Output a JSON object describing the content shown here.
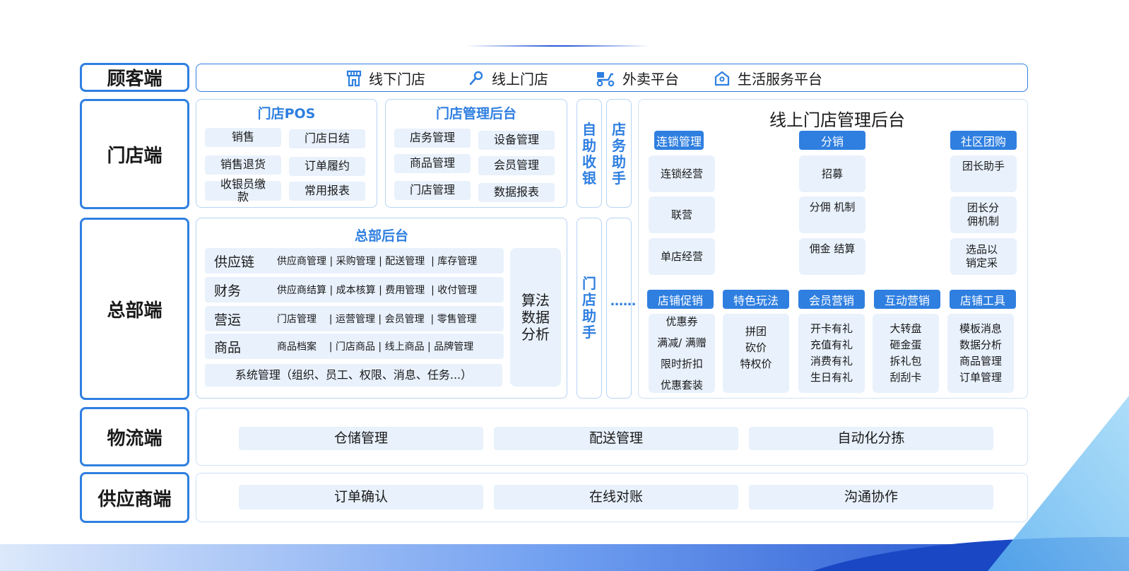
{
  "colors": {
    "accent": "#2f7fe0",
    "chip_bg": "#e8f1fc",
    "panel_border": "#b7d3f4"
  },
  "rows": {
    "customer": "顾客端",
    "store": "门店端",
    "hq": "总部端",
    "logistics": "物流端",
    "supplier": "供应商端"
  },
  "customer_items": [
    {
      "icon": "storefront-icon",
      "label": "线下门店"
    },
    {
      "icon": "link-icon",
      "label": "线上门店"
    },
    {
      "icon": "delivery-scooter-icon",
      "label": "外卖平台"
    },
    {
      "icon": "home-service-icon",
      "label": "生活服务平台"
    }
  ],
  "store_pos": {
    "title": "门店POS",
    "items": [
      "销售",
      "门店日结",
      "销售退货",
      "订单履约",
      "收银员缴款",
      "常用报表"
    ]
  },
  "store_admin": {
    "title": "门店管理后台",
    "items": [
      "店务管理",
      "设备管理",
      "商品管理",
      "会员管理",
      "门店管理",
      "数据报表"
    ]
  },
  "self_checkout": "自助收银",
  "store_assistant": "店务助手",
  "hq": {
    "title": "总部后台",
    "rows": [
      {
        "cat": "供应链",
        "items": "供应商管理 | 采购管理 | 配送管理  | 库存管理"
      },
      {
        "cat": "财务",
        "items": "供应商结算 | 成本核算 | 费用管理  | 收付管理"
      },
      {
        "cat": "营运",
        "items": "门店管理    | 运营管理 | 会员管理  | 零售管理"
      },
      {
        "cat": "商品",
        "items": "商品档案    | 门店商品 | 线上商品 | 品牌管理"
      }
    ],
    "system": "系统管理（组织、员工、权限、消息、任务...）",
    "algo": "算法数据分析"
  },
  "shop_assistant": "门店助手",
  "ellipsis": "……",
  "online": {
    "title": "线上门店管理后台",
    "chain": {
      "head": "连锁管理",
      "items": [
        "连锁经营",
        "联营",
        "单店经营"
      ]
    },
    "distribution": {
      "head": "分销",
      "items": [
        "招募",
        "分佣 机制",
        "佣金 结算"
      ]
    },
    "community": {
      "head": "社区团购",
      "items": [
        "团长助手",
        "团长分佣机制",
        "选品以销定采"
      ]
    },
    "groups": [
      {
        "head": "店铺促销",
        "items": [
          "优惠券",
          "满减/ 满赠",
          "限时折扣",
          "优惠套装"
        ]
      },
      {
        "head": "特色玩法",
        "items": [
          "拼团",
          "砍价",
          "特权价"
        ]
      },
      {
        "head": "会员营销",
        "items": [
          "开卡有礼",
          "充值有礼",
          "消费有礼",
          "生日有礼"
        ]
      },
      {
        "head": "互动营销",
        "items": [
          "大转盘",
          "砸金蛋",
          "拆礼包",
          "刮刮卡"
        ]
      },
      {
        "head": "店铺工具",
        "items": [
          "模板消息",
          "数据分析",
          "商品管理",
          "订单管理"
        ]
      }
    ]
  },
  "logistics_items": [
    "仓储管理",
    "配送管理",
    "自动化分拣"
  ],
  "supplier_items": [
    "订单确认",
    "在线对账",
    "沟通协作"
  ]
}
